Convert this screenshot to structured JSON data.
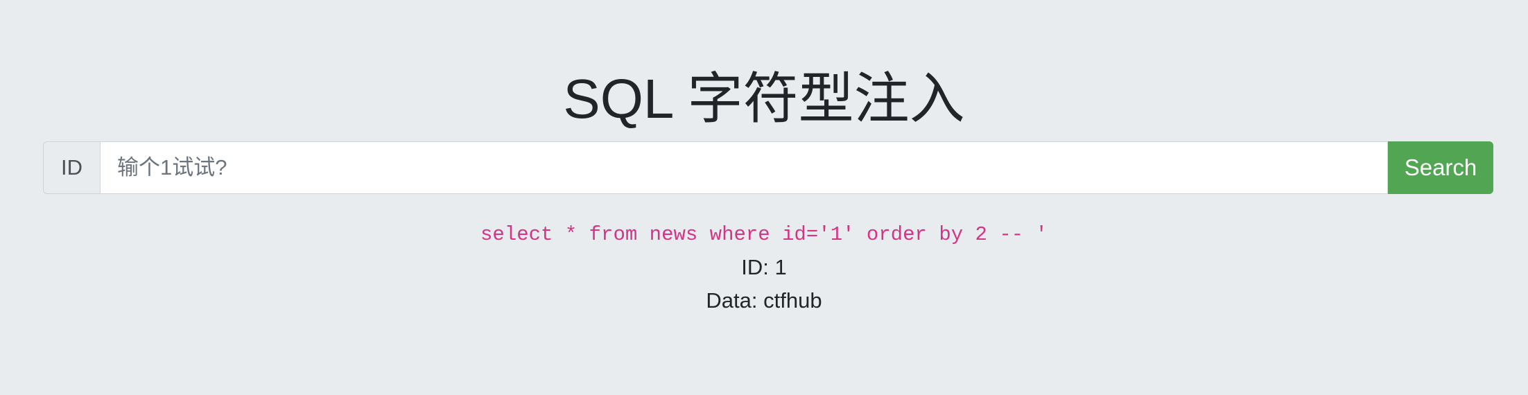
{
  "page": {
    "title": "SQL 字符型注入"
  },
  "search": {
    "prepend_label": "ID",
    "placeholder": "输个1试试?",
    "value": "",
    "button_label": "Search"
  },
  "results": {
    "query": "select * from news where id='1' order by 2 -- '",
    "id_line": "ID: 1",
    "data_line": "Data: ctfhub"
  },
  "colors": {
    "background": "#e9ecef",
    "button": "#52a552",
    "query_text": "#d63384"
  }
}
